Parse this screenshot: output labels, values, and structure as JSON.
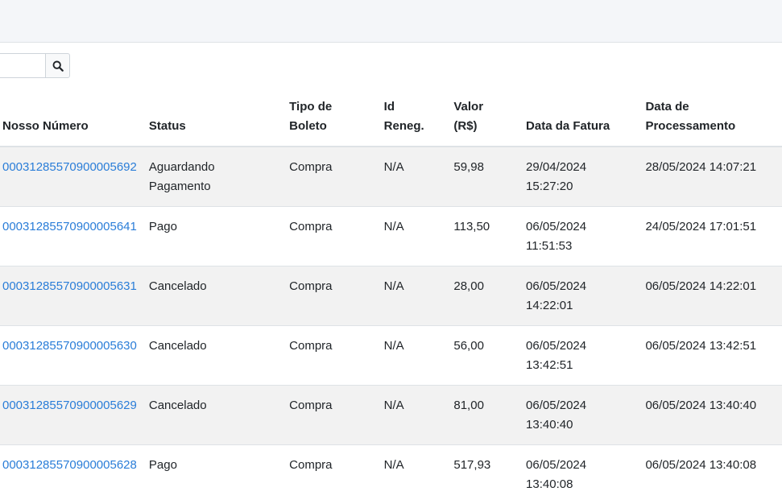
{
  "search": {
    "value": "",
    "placeholder": ""
  },
  "table": {
    "headers": {
      "nosso_numero": "Nosso Número",
      "status": "Status",
      "tipo_line1": "Tipo de",
      "tipo_line2": "Boleto",
      "id_line1": "Id",
      "id_line2": "Reneg.",
      "valor_line1": "Valor",
      "valor_line2": "(R$)",
      "data_fatura": "Data da Fatura",
      "proc_line1": "Data de",
      "proc_line2": "Processamento"
    },
    "rows": [
      {
        "nosso_numero": "00031285570900005692",
        "status_line1": "Aguardando",
        "status_line2": "Pagamento",
        "tipo": "Compra",
        "id_reneg": "N/A",
        "valor": "59,98",
        "fatura_date": "29/04/2024",
        "fatura_time": "15:27:20",
        "processamento": "28/05/2024 14:07:21"
      },
      {
        "nosso_numero": "00031285570900005641",
        "status_line1": "Pago",
        "status_line2": "",
        "tipo": "Compra",
        "id_reneg": "N/A",
        "valor": "113,50",
        "fatura_date": "06/05/2024",
        "fatura_time": "11:51:53",
        "processamento": "24/05/2024 17:01:51"
      },
      {
        "nosso_numero": "00031285570900005631",
        "status_line1": "Cancelado",
        "status_line2": "",
        "tipo": "Compra",
        "id_reneg": "N/A",
        "valor": "28,00",
        "fatura_date": "06/05/2024",
        "fatura_time": "14:22:01",
        "processamento": "06/05/2024 14:22:01"
      },
      {
        "nosso_numero": "00031285570900005630",
        "status_line1": "Cancelado",
        "status_line2": "",
        "tipo": "Compra",
        "id_reneg": "N/A",
        "valor": "56,00",
        "fatura_date": "06/05/2024",
        "fatura_time": "13:42:51",
        "processamento": "06/05/2024 13:42:51"
      },
      {
        "nosso_numero": "00031285570900005629",
        "status_line1": "Cancelado",
        "status_line2": "",
        "tipo": "Compra",
        "id_reneg": "N/A",
        "valor": "81,00",
        "fatura_date": "06/05/2024",
        "fatura_time": "13:40:40",
        "processamento": "06/05/2024 13:40:40"
      },
      {
        "nosso_numero": "00031285570900005628",
        "status_line1": "Pago",
        "status_line2": "",
        "tipo": "Compra",
        "id_reneg": "N/A",
        "valor": "517,93",
        "fatura_date": "06/05/2024",
        "fatura_time": "13:40:08",
        "processamento": "06/05/2024 13:40:08"
      }
    ]
  }
}
